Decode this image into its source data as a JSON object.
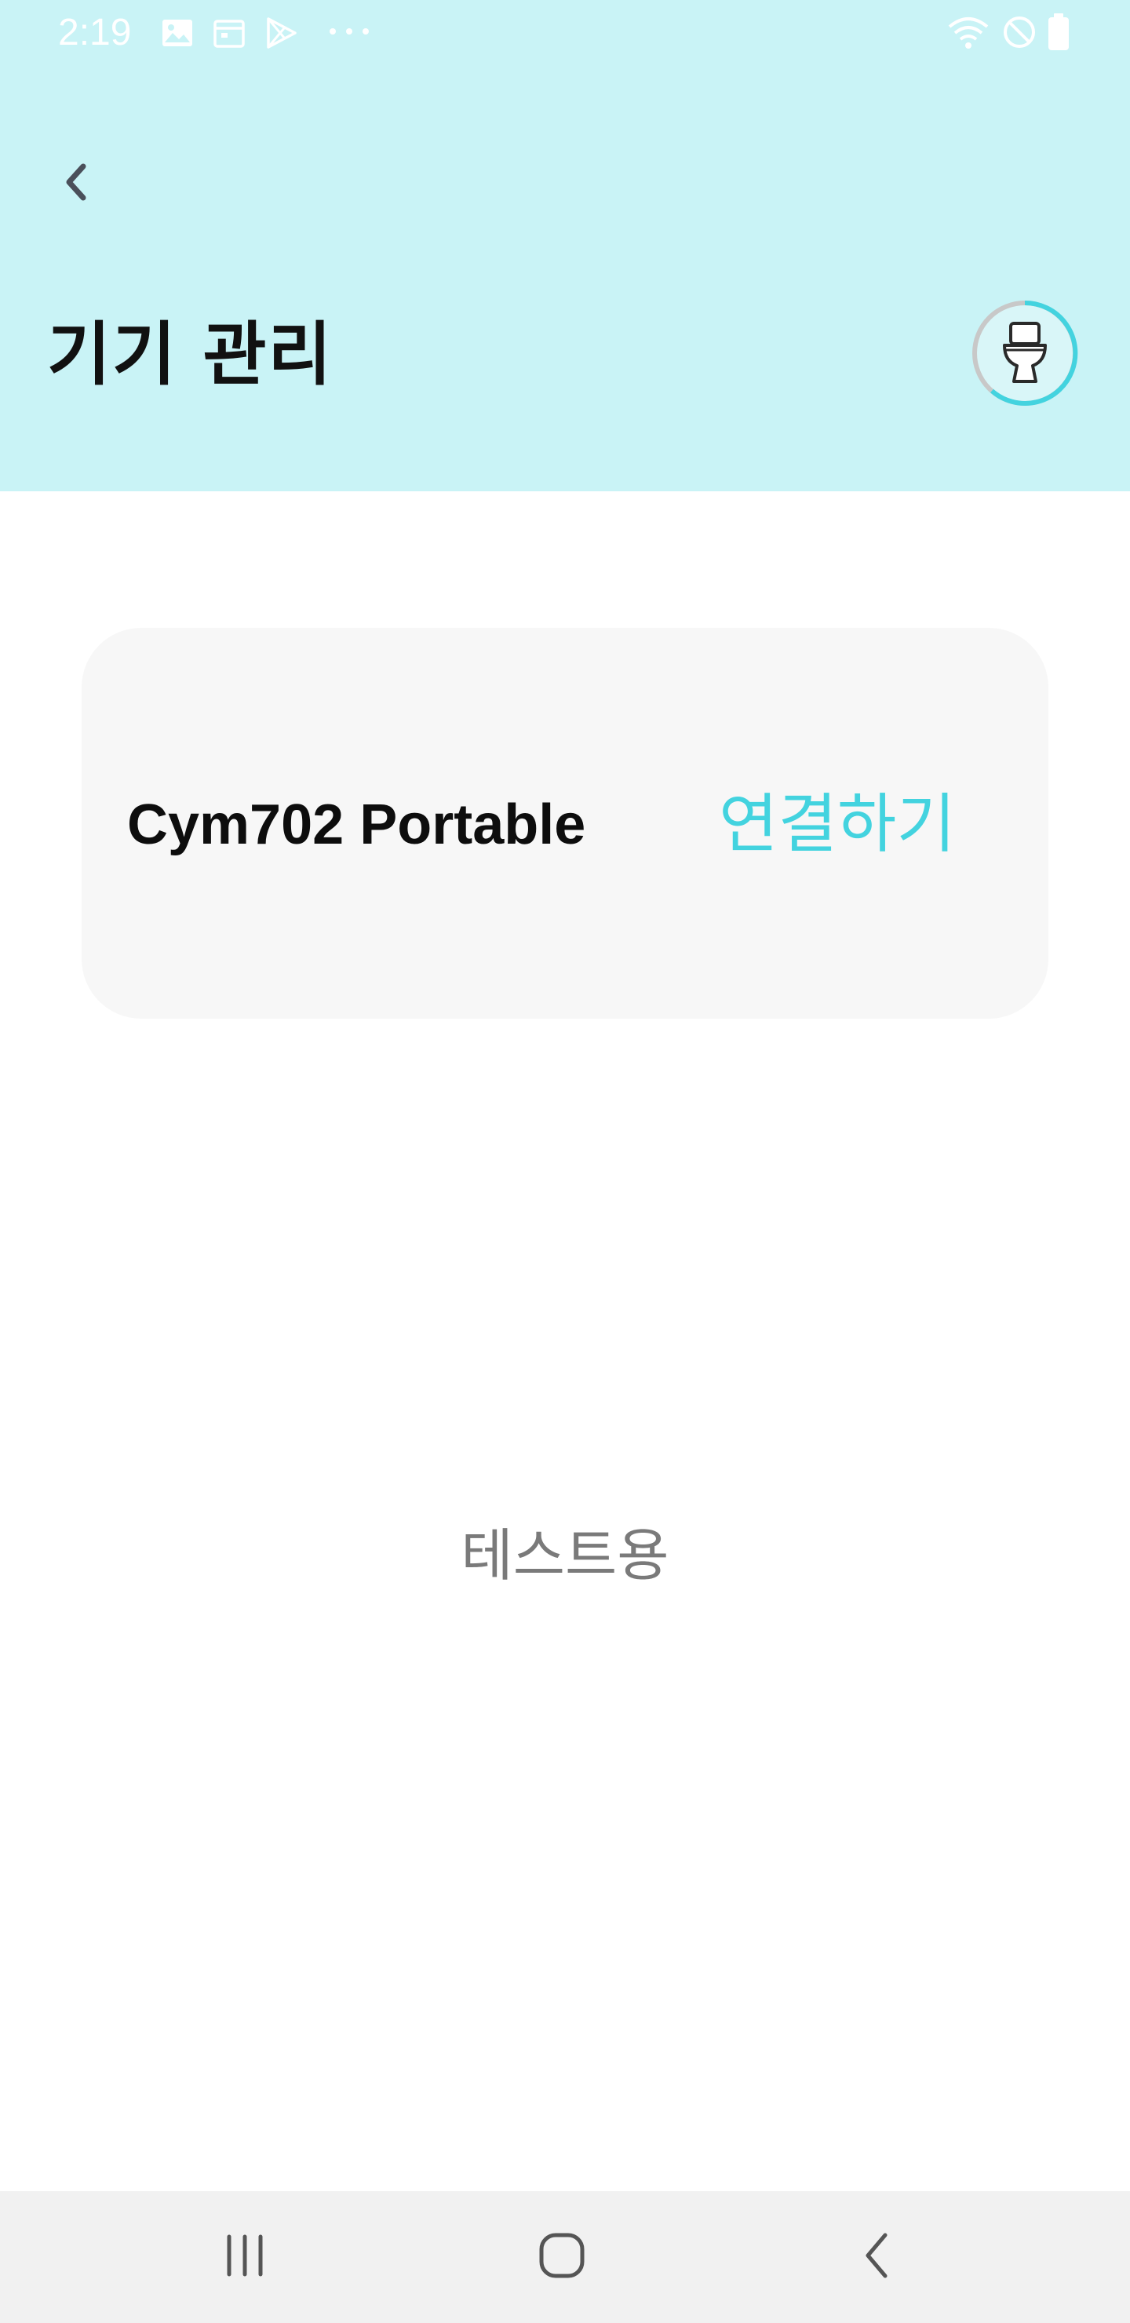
{
  "status_bar": {
    "time": "2:19",
    "left_icons": [
      "gallery-icon",
      "calendar-icon",
      "play-store-icon",
      "more-dots-icon"
    ],
    "right_icons": [
      "wifi-icon",
      "do-not-disturb-icon",
      "battery-icon"
    ]
  },
  "header": {
    "title": "기기 관리",
    "background_color": "#c9f3f6",
    "avatar_icon": "toilet-icon",
    "avatar_ring_color": "#43d3df"
  },
  "device_card": {
    "device_name": "Cym702 Portable",
    "connect_label": "연결하기",
    "connect_color": "#43d3df"
  },
  "footer_text": "테스트용",
  "nav_bar": {
    "buttons": [
      "recent-apps-icon",
      "home-icon",
      "back-icon"
    ]
  }
}
